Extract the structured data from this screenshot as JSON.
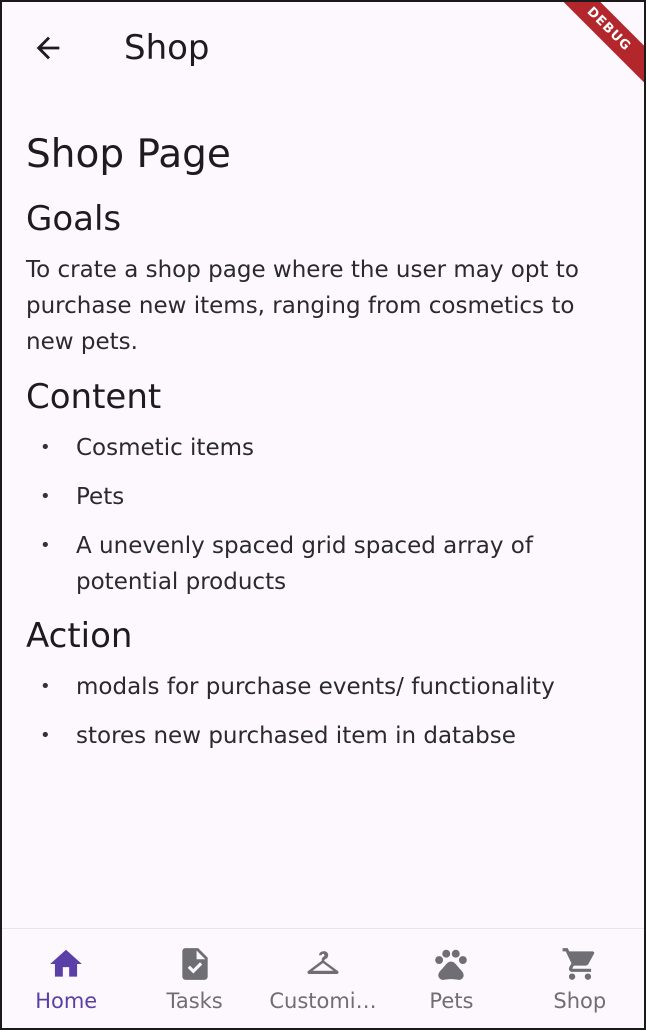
{
  "appbar": {
    "title": "Shop",
    "back_icon": "arrow-back-icon"
  },
  "debug_banner": "DEBUG",
  "content": {
    "page_title": "Shop Page",
    "goals_heading": "Goals",
    "goals_text": "To crate a shop page where the user may opt to purchase new items, ranging from cosmetics to new pets.",
    "content_heading": "Content",
    "content_items": [
      "Cosmetic items",
      "Pets",
      "A unevenly spaced grid spaced array of potential products"
    ],
    "action_heading": "Action",
    "action_items": [
      "modals for purchase events/ functionality",
      "stores new purchased item in databse"
    ]
  },
  "bottom_nav": {
    "items": [
      {
        "label": "Home",
        "icon": "home-icon",
        "active": true
      },
      {
        "label": "Tasks",
        "icon": "task-document-icon",
        "active": false
      },
      {
        "label": "Customi…",
        "icon": "hanger-icon",
        "active": false
      },
      {
        "label": "Pets",
        "icon": "paw-icon",
        "active": false
      },
      {
        "label": "Shop",
        "icon": "shopping-cart-icon",
        "active": false
      }
    ]
  },
  "colors": {
    "active": "#5b3fa8",
    "inactive": "#6e6e74",
    "background": "#fdf8fd",
    "debug": "#b3262b"
  }
}
